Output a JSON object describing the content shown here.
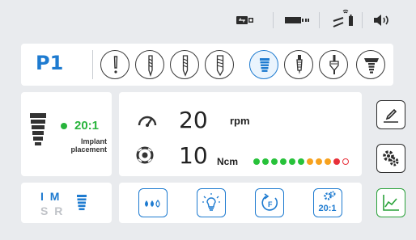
{
  "status_bar": {
    "icons": [
      "usb-connection-icon",
      "foot-pedal-battery-icon",
      "wireless-pedal-signal-icon",
      "volume-icon"
    ]
  },
  "step": {
    "label": "P1",
    "tools": [
      {
        "icon": "pilot-drill-icon",
        "active": false
      },
      {
        "icon": "twist-drill-icon",
        "active": false
      },
      {
        "icon": "step-drill-small-icon",
        "active": false
      },
      {
        "icon": "step-drill-large-icon",
        "active": false
      },
      {
        "icon": "implant-tool-icon",
        "active": true
      },
      {
        "icon": "tap-drill-icon",
        "active": false
      },
      {
        "icon": "countersink-icon",
        "active": false
      },
      {
        "icon": "abutment-icon",
        "active": false
      }
    ]
  },
  "implant": {
    "ratio": "20:1",
    "mode_line1": "Implant",
    "mode_line2": "placement",
    "ratio_color": "#28b43c"
  },
  "readout": {
    "speed_value": "20",
    "speed_unit": "rpm",
    "torque_value": "10",
    "torque_unit": "Ncm",
    "torque_level": {
      "filled": 10,
      "total": 11,
      "colors": [
        "#27c23a",
        "#27c23a",
        "#27c23a",
        "#27c23a",
        "#27c23a",
        "#27c23a",
        "#f7a21e",
        "#f7a21e",
        "#f7a21e",
        "#e8303a",
        "#e8303a"
      ]
    }
  },
  "side_buttons": [
    {
      "name": "edit-button",
      "icon": "edit-icon"
    },
    {
      "name": "settings-button",
      "icon": "settings-gear-icon"
    },
    {
      "name": "torque-curve-button",
      "icon": "chart-icon"
    }
  ],
  "mode": {
    "active": "I M",
    "inactive": "S R"
  },
  "functions": {
    "irrigation_icon": "irrigation-drops-icon",
    "light_icon": "light-bulb-icon",
    "rotation_icon": "forward-rotation-icon",
    "ratio_label": "20:1",
    "ratio_icon": "contra-angle-gear-icon"
  },
  "colors": {
    "accent": "#1e7bd0",
    "ok": "#28b43c",
    "background": "#e9ebee"
  }
}
